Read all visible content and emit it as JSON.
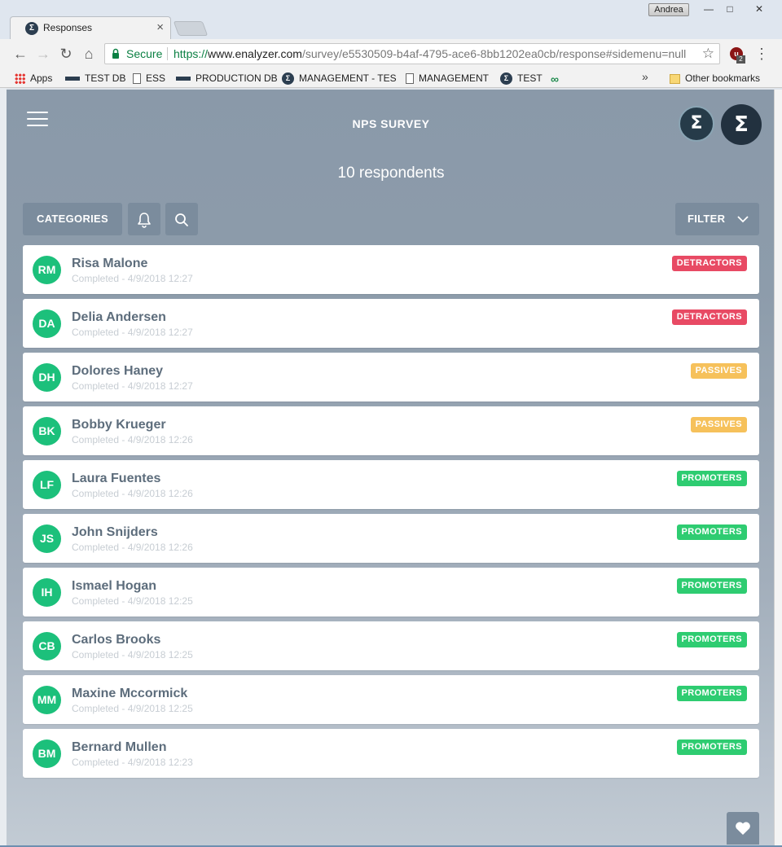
{
  "browser": {
    "user_name": "Andrea",
    "tab_title": "Responses",
    "secure_label": "Secure",
    "url_https": "https://",
    "url_host": "www.enalyzer.com",
    "url_path": "/survey/e5530509-b4af-4795-ace6-8bb1202ea0cb/response#sidemenu=null",
    "extension_badge": "2",
    "bookmarks": [
      {
        "label": "Apps",
        "icon": "apps-grid-icon"
      },
      {
        "label": "TEST DB",
        "icon": "database-icon"
      },
      {
        "label": "ESS",
        "icon": "document-icon"
      },
      {
        "label": "PRODUCTION DB",
        "icon": "database-icon"
      },
      {
        "label": "MANAGEMENT - TES",
        "icon": "enalyzer-icon"
      },
      {
        "label": "MANAGEMENT",
        "icon": "document-icon"
      },
      {
        "label": "TEST",
        "icon": "enalyzer-icon"
      },
      {
        "label": "",
        "icon": "infinity-icon"
      }
    ],
    "other_bookmarks": "Other bookmarks"
  },
  "app": {
    "title": "NPS SURVEY",
    "respondent_count": "10 respondents",
    "categories_label": "CATEGORIES",
    "filter_label": "FILTER"
  },
  "colors": {
    "detractors": "#e84a64",
    "passives": "#f6c15b",
    "promoters": "#2ecc71",
    "avatar": "#1cc07b"
  },
  "respondents": [
    {
      "initials": "RM",
      "name": "Risa Malone",
      "status": "Completed - 4/9/2018 12:27",
      "category": "DETRACTORS"
    },
    {
      "initials": "DA",
      "name": "Delia Andersen",
      "status": "Completed - 4/9/2018 12:27",
      "category": "DETRACTORS"
    },
    {
      "initials": "DH",
      "name": "Dolores Haney",
      "status": "Completed - 4/9/2018 12:27",
      "category": "PASSIVES"
    },
    {
      "initials": "BK",
      "name": "Bobby Krueger",
      "status": "Completed - 4/9/2018 12:26",
      "category": "PASSIVES"
    },
    {
      "initials": "LF",
      "name": "Laura Fuentes",
      "status": "Completed - 4/9/2018 12:26",
      "category": "PROMOTERS"
    },
    {
      "initials": "JS",
      "name": "John Snijders",
      "status": "Completed - 4/9/2018 12:26",
      "category": "PROMOTERS"
    },
    {
      "initials": "IH",
      "name": "Ismael Hogan",
      "status": "Completed - 4/9/2018 12:25",
      "category": "PROMOTERS"
    },
    {
      "initials": "CB",
      "name": "Carlos Brooks",
      "status": "Completed - 4/9/2018 12:25",
      "category": "PROMOTERS"
    },
    {
      "initials": "MM",
      "name": "Maxine Mccormick",
      "status": "Completed - 4/9/2018 12:25",
      "category": "PROMOTERS"
    },
    {
      "initials": "BM",
      "name": "Bernard Mullen",
      "status": "Completed - 4/9/2018 12:23",
      "category": "PROMOTERS"
    }
  ]
}
